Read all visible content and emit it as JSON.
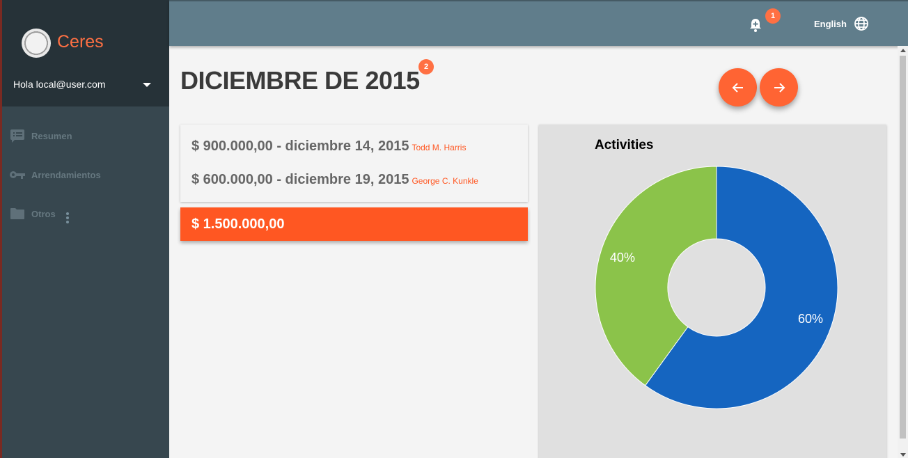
{
  "sidebar": {
    "brand": "Ceres",
    "user_label": "Hola local@user.com",
    "items": [
      {
        "label": "Resumen",
        "icon": "list-icon"
      },
      {
        "label": "Arrendamientos",
        "icon": "key-icon"
      },
      {
        "label": "Otros",
        "icon": "folder-icon"
      }
    ]
  },
  "topbar": {
    "notification_count": "1",
    "language": "English"
  },
  "main": {
    "title": "DICIEMBRE DE 2015",
    "title_badge": "2",
    "payments": [
      {
        "amount": "$ 900.000,00 - diciembre 14, 2015",
        "payer": "Todd M. Harris"
      },
      {
        "amount": "$ 600.000,00 - diciembre 19, 2015",
        "payer": "George C. Kunkle"
      }
    ],
    "total": "$ 1.500.000,00"
  },
  "colors": {
    "accent": "#ff5722",
    "sidebar": "#37474f",
    "topbar": "#607d8b",
    "series_blue": "#1565c0",
    "series_green": "#8bc34a"
  },
  "chart_data": {
    "type": "pie",
    "title": "Activities",
    "donut": true,
    "series": [
      {
        "value": 60,
        "label": "60%",
        "color": "#1565c0"
      },
      {
        "value": 40,
        "label": "40%",
        "color": "#8bc34a"
      }
    ]
  }
}
